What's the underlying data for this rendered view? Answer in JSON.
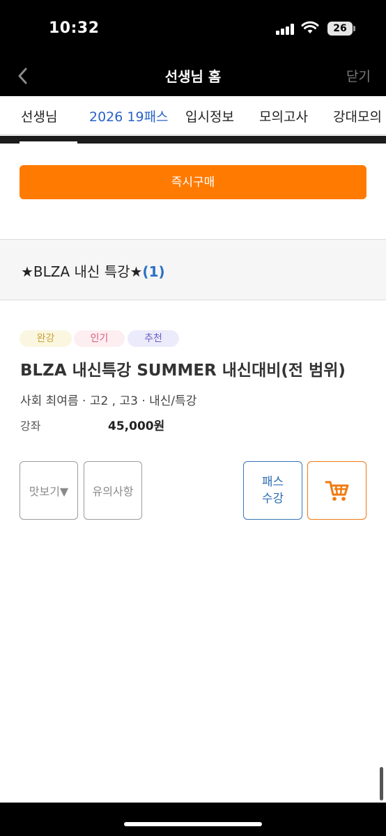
{
  "status_bar": {
    "time": "10:32",
    "battery": "26"
  },
  "nav": {
    "title": "선생님 홈",
    "close_label": "닫기"
  },
  "tabs": [
    {
      "label": "선생님",
      "active": false
    },
    {
      "label": "2026 19패스",
      "active": true
    },
    {
      "label": "입시정보",
      "active": false
    },
    {
      "label": "모의고사",
      "active": false
    },
    {
      "label": "강대모의",
      "active": false
    }
  ],
  "buy_button": {
    "label": "즉시구매"
  },
  "section": {
    "title": "★BLZA 내신 특강★",
    "count": "(1)"
  },
  "course": {
    "badges": [
      "완강",
      "인기",
      "추천"
    ],
    "title": "BLZA 내신특강 SUMMER 내신대비(전 범위)",
    "meta": "사회 최여름 · 고2 , 고3 · 내신/특강",
    "price_label": "강좌",
    "price": "45,000원"
  },
  "actions": {
    "preview": "맛보기▼",
    "notice": "유의사항",
    "pass_line1": "패스",
    "pass_line2": "수강",
    "cart_icon": "cart-icon"
  },
  "colors": {
    "accent_orange": "#ff7a00",
    "active_tab_blue": "#2a62c9",
    "pass_blue": "#2c6db2"
  }
}
